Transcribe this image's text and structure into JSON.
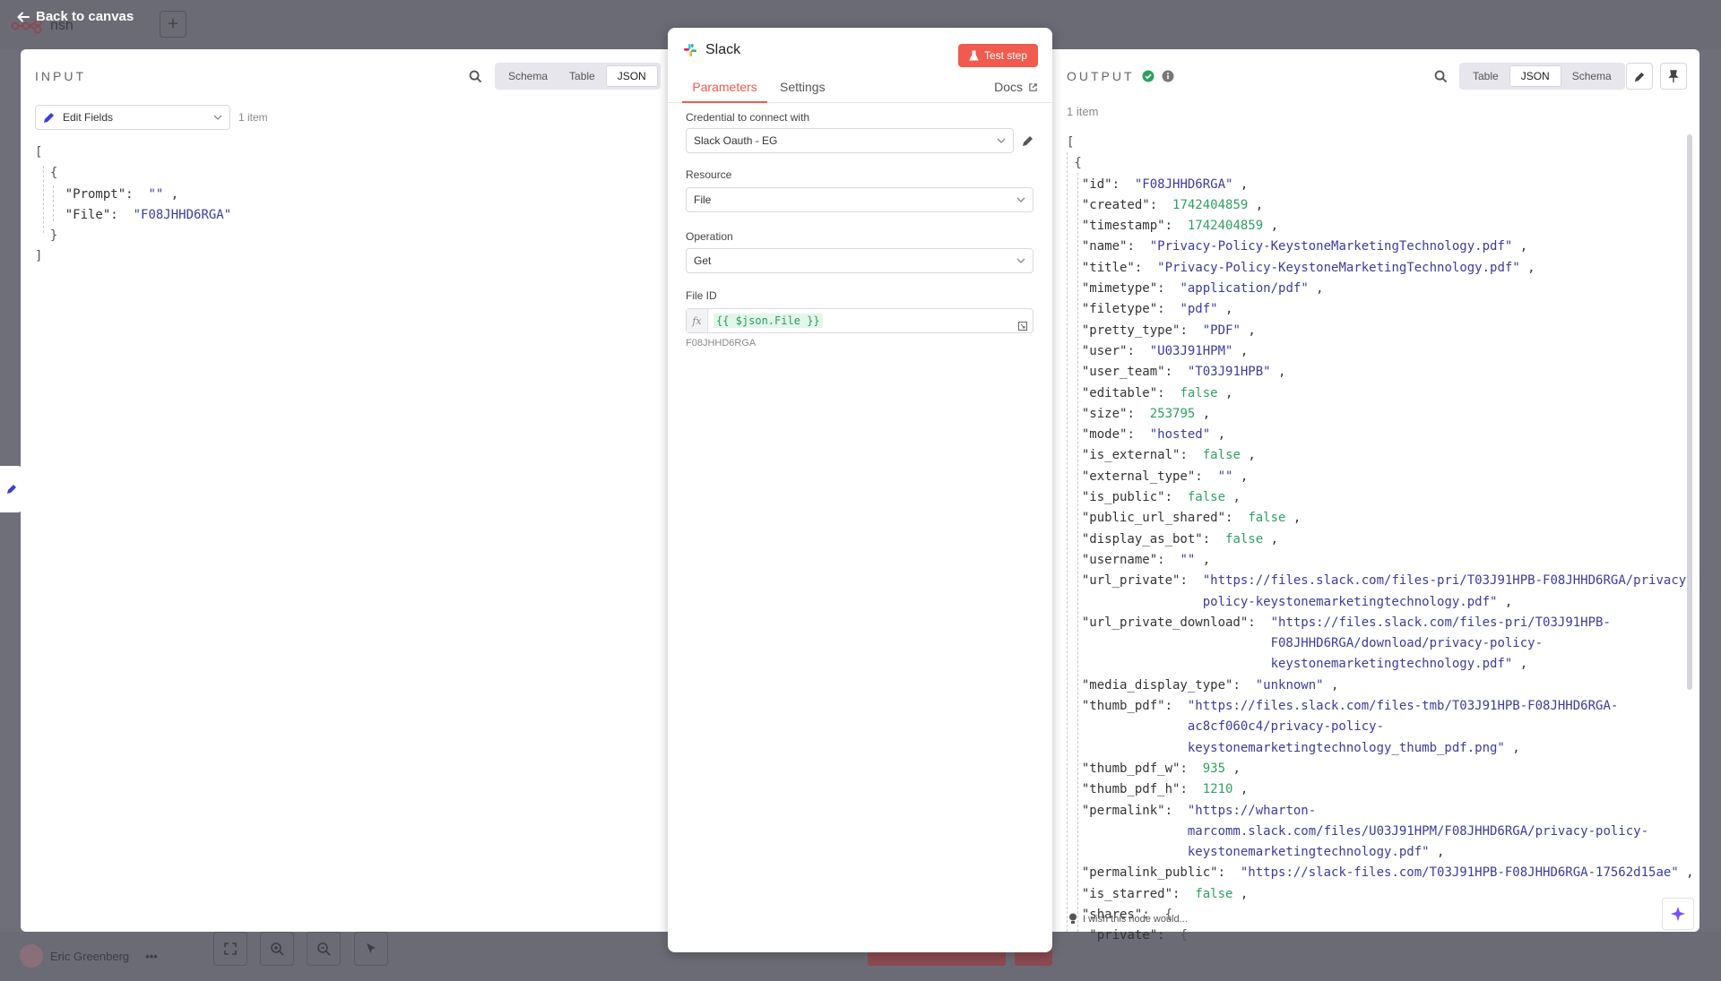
{
  "canvas": {
    "back_label": "Back to canvas",
    "workflow_title": "nsh",
    "add_label": "+",
    "user_name": "Eric Greenberg",
    "more_label": "•••"
  },
  "input": {
    "label": "INPUT",
    "view_tabs": [
      "Schema",
      "Table",
      "JSON"
    ],
    "active_view": "JSON",
    "source_node": "Edit Fields",
    "item_count": "1 item",
    "json_lines": [
      {
        "t": "["
      },
      {
        "t": "  {"
      },
      {
        "k": "\"Prompt\"",
        "s": "\"\""
      },
      {
        "k": "\"File\"",
        "s": "\"F08JHHD6RGA\"",
        "last": true
      },
      {
        "t": "  }"
      },
      {
        "t": "]"
      }
    ]
  },
  "node": {
    "title": "Slack",
    "test_button": "Test step",
    "tabs": {
      "parameters": "Parameters",
      "settings": "Settings",
      "docs": "Docs"
    },
    "credential_label": "Credential to connect with",
    "credential_value": "Slack Oauth - EG",
    "resource_label": "Resource",
    "resource_value": "File",
    "operation_label": "Operation",
    "operation_value": "Get",
    "file_id_label": "File ID",
    "file_id_expression": "{{ $json.File }}",
    "file_id_fx": "fx",
    "file_id_resolved": "F08JHHD6RGA"
  },
  "output": {
    "label": "OUTPUT",
    "view_tabs": [
      "Table",
      "JSON",
      "Schema"
    ],
    "active_view": "JSON",
    "item_count": "1 item",
    "footer_hint": "I wish this node would...",
    "fields": [
      {
        "k": "id",
        "v": "\"F08JHHD6RGA\"",
        "type": "s"
      },
      {
        "k": "created",
        "v": "1742404859",
        "type": "n"
      },
      {
        "k": "timestamp",
        "v": "1742404859",
        "type": "n"
      },
      {
        "k": "name",
        "v": "\"Privacy-Policy-KeystoneMarketingTechnology.pdf\"",
        "type": "s"
      },
      {
        "k": "title",
        "v": "\"Privacy-Policy-KeystoneMarketingTechnology.pdf\"",
        "type": "s"
      },
      {
        "k": "mimetype",
        "v": "\"application/pdf\"",
        "type": "s"
      },
      {
        "k": "filetype",
        "v": "\"pdf\"",
        "type": "s"
      },
      {
        "k": "pretty_type",
        "v": "\"PDF\"",
        "type": "s"
      },
      {
        "k": "user",
        "v": "\"U03J91HPM\"",
        "type": "s"
      },
      {
        "k": "user_team",
        "v": "\"T03J91HPB\"",
        "type": "s"
      },
      {
        "k": "editable",
        "v": "false",
        "type": "b"
      },
      {
        "k": "size",
        "v": "253795",
        "type": "n"
      },
      {
        "k": "mode",
        "v": "\"hosted\"",
        "type": "s"
      },
      {
        "k": "is_external",
        "v": "false",
        "type": "b"
      },
      {
        "k": "external_type",
        "v": "\"\"",
        "type": "s"
      },
      {
        "k": "is_public",
        "v": "false",
        "type": "b"
      },
      {
        "k": "public_url_shared",
        "v": "false",
        "type": "b"
      },
      {
        "k": "display_as_bot",
        "v": "false",
        "type": "b"
      },
      {
        "k": "username",
        "v": "\"\"",
        "type": "s"
      },
      {
        "k": "url_private",
        "v": [
          "\"https://files.slack.com/files-pri/T03J91HPB-F08JHHD6RGA/privacy-",
          "policy-keystonemarketingtechnology.pdf\""
        ],
        "type": "s"
      },
      {
        "k": "url_private_download",
        "v": [
          "\"https://files.slack.com/files-pri/T03J91HPB-",
          "F08JHHD6RGA/download/privacy-policy-",
          "keystonemarketingtechnology.pdf\""
        ],
        "type": "s"
      },
      {
        "k": "media_display_type",
        "v": "\"unknown\"",
        "type": "s"
      },
      {
        "k": "thumb_pdf",
        "v": [
          "\"https://files.slack.com/files-tmb/T03J91HPB-F08JHHD6RGA-",
          "ac8cf060c4/privacy-policy-",
          "keystonemarketingtechnology_thumb_pdf.png\""
        ],
        "type": "s"
      },
      {
        "k": "thumb_pdf_w",
        "v": "935",
        "type": "n"
      },
      {
        "k": "thumb_pdf_h",
        "v": "1210",
        "type": "n"
      },
      {
        "k": "permalink",
        "v": [
          "\"https://wharton-",
          "marcomm.slack.com/files/U03J91HPM/F08JHHD6RGA/privacy-policy-",
          "keystonemarketingtechnology.pdf\""
        ],
        "type": "s"
      },
      {
        "k": "permalink_public",
        "v": "\"https://slack-files.com/T03J91HPB-F08JHHD6RGA-17562d15ae\"",
        "type": "s"
      },
      {
        "k": "is_starred",
        "v": "false",
        "type": "b"
      },
      {
        "k": "shares",
        "v": "{",
        "type": "p",
        "nocomma": true
      },
      {
        "k": "private",
        "v": "{",
        "type": "p",
        "nocomma": true,
        "indent": 2
      }
    ]
  },
  "colors": {
    "accent": "#f15a4e",
    "success": "#2f9f62",
    "string": "#3b3c9a"
  }
}
